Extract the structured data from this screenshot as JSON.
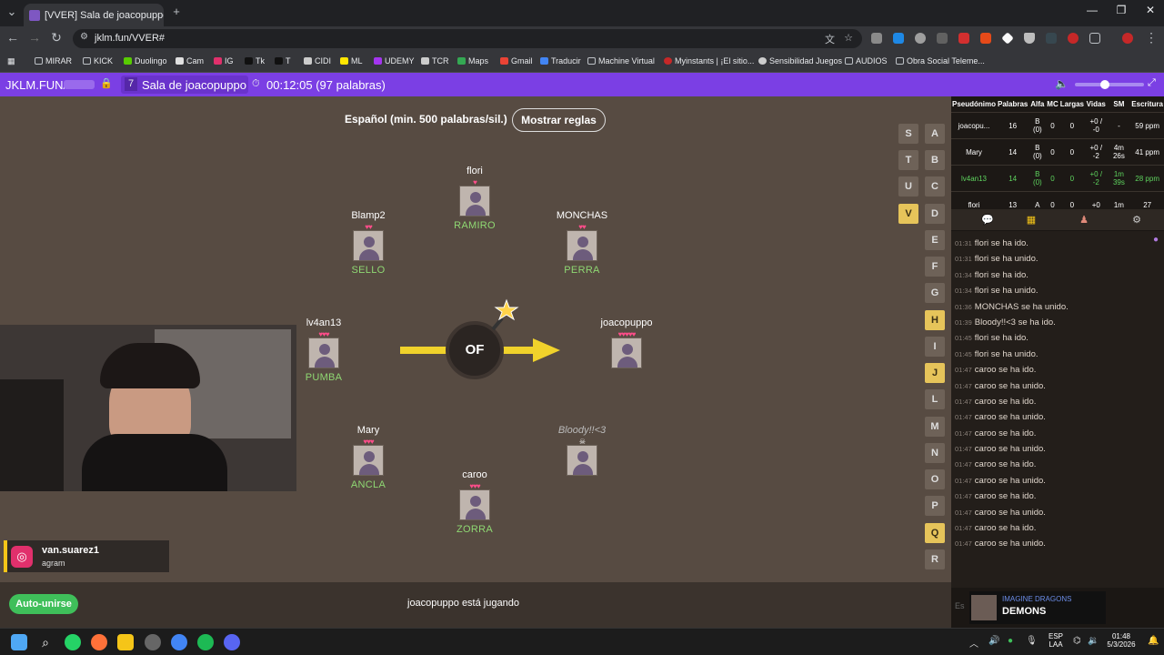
{
  "browser": {
    "tab_title": "[VVER] Sala de joacopuppo",
    "url": "jklm.fun/VVER#",
    "bookmarks": [
      "MIRAR",
      "KICK",
      "Duolingo",
      "Cam",
      "IG",
      "Tk",
      "T",
      "CIDI",
      "ML",
      "UDEMY",
      "TCR",
      "Maps",
      "Gmail",
      "Traducir",
      "Machine Virtual",
      "Myinstants | ¡El sitio...",
      "Sensibilidad Juegos",
      "AUDIOS",
      "Obra Social Teleme..."
    ]
  },
  "header": {
    "site": "JKLM.FUN/",
    "room_count": "7",
    "room_name": "Sala de joacopuppo",
    "timer": "00:12:05 (97 palabras)"
  },
  "game": {
    "language": "Español (min. 500 palabras/sil.)",
    "rules_button": "Mostrar reglas",
    "syllable": "OF",
    "status": "joacopuppo está jugando",
    "autojoin": "Auto-unirse",
    "players": [
      {
        "name": "flori",
        "hearts": "♥",
        "word": "RAMIRO"
      },
      {
        "name": "Blamp2",
        "hearts": "♥♥",
        "word": "SELLO"
      },
      {
        "name": "MONCHAS",
        "hearts": "♥♥",
        "word": "PERRA"
      },
      {
        "name": "lv4an13",
        "hearts": "♥♥♥",
        "word": "PUMBA"
      },
      {
        "name": "joacopuppo",
        "hearts": "♥♥♥♥♥",
        "word": ""
      },
      {
        "name": "Mary",
        "hearts": "♥♥♥",
        "word": "ANCLA"
      },
      {
        "name": "Bloody!!<3",
        "hearts": "☠",
        "word": ""
      },
      {
        "name": "caroo",
        "hearts": "♥♥♥",
        "word": "ZORRA"
      }
    ],
    "letters_left": [
      "S",
      "T",
      "U",
      "V"
    ],
    "letters_right": [
      "A",
      "B",
      "C",
      "D",
      "E",
      "F",
      "G",
      "H",
      "I",
      "J",
      "L",
      "M",
      "N",
      "O",
      "P",
      "Q",
      "R"
    ],
    "used_letters": [
      "V",
      "H",
      "J",
      "Q"
    ]
  },
  "scoreboard": {
    "headers": [
      "Pseudónimo",
      "Palabras",
      "Alfa",
      "MC",
      "Largas",
      "Vidas",
      "SM",
      "Escritura"
    ],
    "rows": [
      [
        "joacopu...",
        "16",
        "B (0)",
        "0",
        "0",
        "+0 / -0",
        "-",
        "59 ppm"
      ],
      [
        "Mary",
        "14",
        "B (0)",
        "0",
        "0",
        "+0 / -2",
        "4m 26s",
        "41 ppm"
      ],
      [
        "lv4an13",
        "14",
        "B (0)",
        "0",
        "0",
        "+0 / -2",
        "1m 39s",
        "28 ppm"
      ],
      [
        "flori",
        "13",
        "A",
        "0",
        "0",
        "+0",
        "1m",
        "27"
      ]
    ],
    "highlight_color": "#5ed35e"
  },
  "chat": [
    [
      "01:31",
      "flori se ha ido."
    ],
    [
      "01:31",
      "flori se ha unido."
    ],
    [
      "01:34",
      "flori se ha ido."
    ],
    [
      "01:34",
      "flori se ha unido."
    ],
    [
      "01:36",
      "MONCHAS se ha unido."
    ],
    [
      "01:39",
      "Bloody!!<3 se ha ido."
    ],
    [
      "01:45",
      "flori se ha ido."
    ],
    [
      "01:45",
      "flori se ha unido."
    ],
    [
      "01:47",
      "caroo se ha ido."
    ],
    [
      "01:47",
      "caroo se ha unido."
    ],
    [
      "01:47",
      "caroo se ha ido."
    ],
    [
      "01:47",
      "caroo se ha unido."
    ],
    [
      "01:47",
      "caroo se ha ido."
    ],
    [
      "01:47",
      "caroo se ha unido."
    ],
    [
      "01:47",
      "caroo se ha ido."
    ],
    [
      "01:47",
      "caroo se ha unido."
    ],
    [
      "01:47",
      "caroo se ha ido."
    ],
    [
      "01:47",
      "caroo se ha unido."
    ],
    [
      "01:47",
      "caroo se ha ido."
    ],
    [
      "01:47",
      "caroo se ha unido."
    ]
  ],
  "music": {
    "artist": "IMAGINE DRAGONS",
    "title": "DEMONS"
  },
  "overlay": {
    "instagram_user": "van.suarez1",
    "instagram_label": "agram"
  },
  "taskbar": {
    "lang1": "ESP",
    "lang2": "LAA",
    "time": "01:48",
    "date": "5/3/2026"
  },
  "colors": {
    "accent": "#7b3fe4",
    "bomb_arrow": "#f0d22b",
    "autojoin": "#3fbf5a",
    "heart": "#ff4d8a"
  }
}
